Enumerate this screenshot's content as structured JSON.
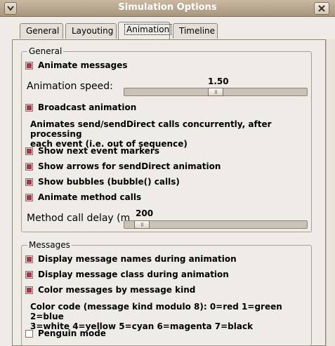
{
  "window": {
    "title": "Simulation Options"
  },
  "tabs": [
    {
      "label": "General"
    },
    {
      "label": "Layouting"
    },
    {
      "label": "Animation"
    },
    {
      "label": "Timeline"
    }
  ],
  "general": {
    "legend": "General",
    "animate_messages": "Animate messages",
    "animation_speed_label": "Animation speed:",
    "animation_speed_value": "1.50",
    "animation_speed_fraction": 0.5,
    "broadcast_animation": "Broadcast animation",
    "broadcast_desc_line1": "Animates send/sendDirect calls concurrently, after processing",
    "broadcast_desc_line2": "each event (i.e. out of sequence)",
    "show_next_event_markers": "Show next event markers",
    "show_arrows": "Show arrows for sendDirect animation",
    "show_bubbles": "Show bubbles (bubble() calls)",
    "animate_method_calls": "Animate method calls",
    "method_call_delay_label": "Method call delay (m",
    "method_call_delay_value": "200",
    "method_call_delay_fraction": 0.06
  },
  "messages": {
    "legend": "Messages",
    "display_names": "Display message names during animation",
    "display_class": "Display message class during animation",
    "color_by_kind": "Color messages by message kind",
    "color_code_line1": "Color code (message kind modulo 8): 0=red 1=green 2=blue",
    "color_code_line2": "3=white 4=yellow 5=cyan 6=magenta 7=black",
    "penguin_mode": "Penguin mode"
  },
  "colors": {
    "checkmark": "#9a3a53",
    "titlebar": "#b3a28b"
  },
  "icons": {
    "window_menu": "chevron-down-icon",
    "close": "close-icon"
  }
}
